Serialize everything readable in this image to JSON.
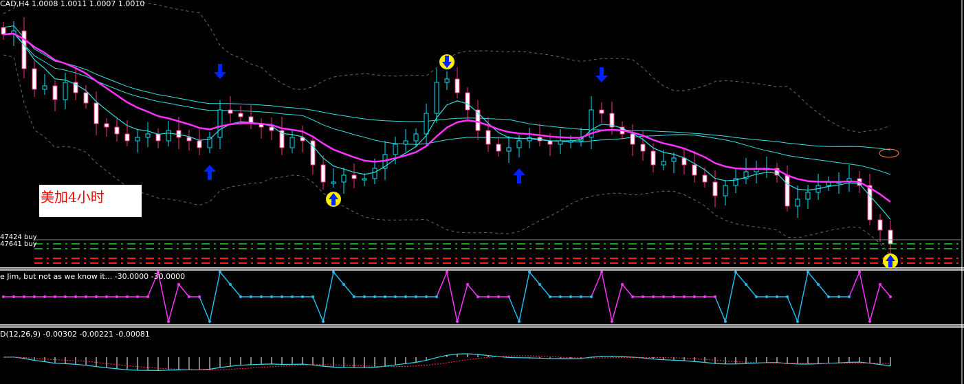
{
  "header": {
    "symbol_info": "CAD,H4  1.0008 1.0011 1.0007 1.0010"
  },
  "annotation": {
    "text": "美加4小时"
  },
  "order_lines": [
    {
      "label": "47424 buy",
      "color": "#8a8aa0"
    },
    {
      "label": "47641 buy",
      "color": "#22cc22"
    }
  ],
  "indicator_panel": {
    "title": "e Jim, but not as we know it...  -30.0000 -30.0000"
  },
  "macd_panel": {
    "title": "D(12,26,9) -0.00302 -0.00221 -0.00081"
  },
  "colors": {
    "bull": "#00e5ff",
    "bear_body": "#ffffff",
    "bear_edge": "#ff2d8a",
    "ma_slow": "#ff33ff",
    "ma_fast": "#33e0e0",
    "band": "#6a6a6a",
    "buy_line": "#22cc22",
    "sell_line": "#ff1a1a"
  },
  "chart_data": {
    "type": "candlestick",
    "title": "CAD,H4",
    "ylim": [
      0.999,
      1.038
    ],
    "closes": [
      1.033,
      1.0335,
      1.028,
      1.025,
      1.0255,
      1.0235,
      1.026,
      1.0245,
      1.023,
      1.02,
      1.0195,
      1.0185,
      1.0175,
      1.018,
      1.0185,
      1.0175,
      1.019,
      1.018,
      1.0175,
      1.0165,
      1.018,
      1.022,
      1.0215,
      1.021,
      1.02,
      1.0195,
      1.019,
      1.0165,
      1.018,
      1.0175,
      1.014,
      1.0115,
      1.0115,
      1.0125,
      1.012,
      1.012,
      1.0135,
      1.0155,
      1.017,
      1.0175,
      1.0185,
      1.0215,
      1.026,
      1.0265,
      1.0245,
      1.022,
      1.019,
      1.017,
      1.016,
      1.0165,
      1.0175,
      1.018,
      1.0175,
      1.017,
      1.0175,
      1.0175,
      1.018,
      1.022,
      1.0215,
      1.0195,
      1.0185,
      1.017,
      1.016,
      1.014,
      1.0145,
      1.015,
      1.014,
      1.0125,
      1.0115,
      1.0095,
      1.011,
      1.012,
      1.013,
      1.0135,
      1.0135,
      1.0125,
      1.008,
      1.009,
      1.01,
      1.011,
      1.0115,
      1.0115,
      1.012,
      1.011,
      1.006,
      1.0045,
      1.0025
    ],
    "signals": [
      {
        "i": 20,
        "type": "arrow-up"
      },
      {
        "i": 21,
        "type": "arrow-down"
      },
      {
        "i": 32,
        "type": "circle-up"
      },
      {
        "i": 43,
        "type": "circle-down"
      },
      {
        "i": 50,
        "type": "arrow-up"
      },
      {
        "i": 58,
        "type": "arrow-down"
      },
      {
        "i": 86,
        "type": "circle-up"
      }
    ],
    "jim_turns": [
      {
        "i": 15,
        "color": "magenta"
      },
      {
        "i": 20,
        "color": "cyan"
      },
      {
        "i": 31,
        "color": "cyan"
      },
      {
        "i": 43,
        "color": "magenta"
      },
      {
        "i": 50,
        "color": "cyan"
      },
      {
        "i": 58,
        "color": "magenta"
      },
      {
        "i": 70,
        "color": "cyan"
      },
      {
        "i": 77,
        "color": "cyan"
      },
      {
        "i": 83,
        "color": "magenta"
      }
    ],
    "jim_level": -30,
    "macd_params": [
      12,
      26,
      9
    ]
  }
}
